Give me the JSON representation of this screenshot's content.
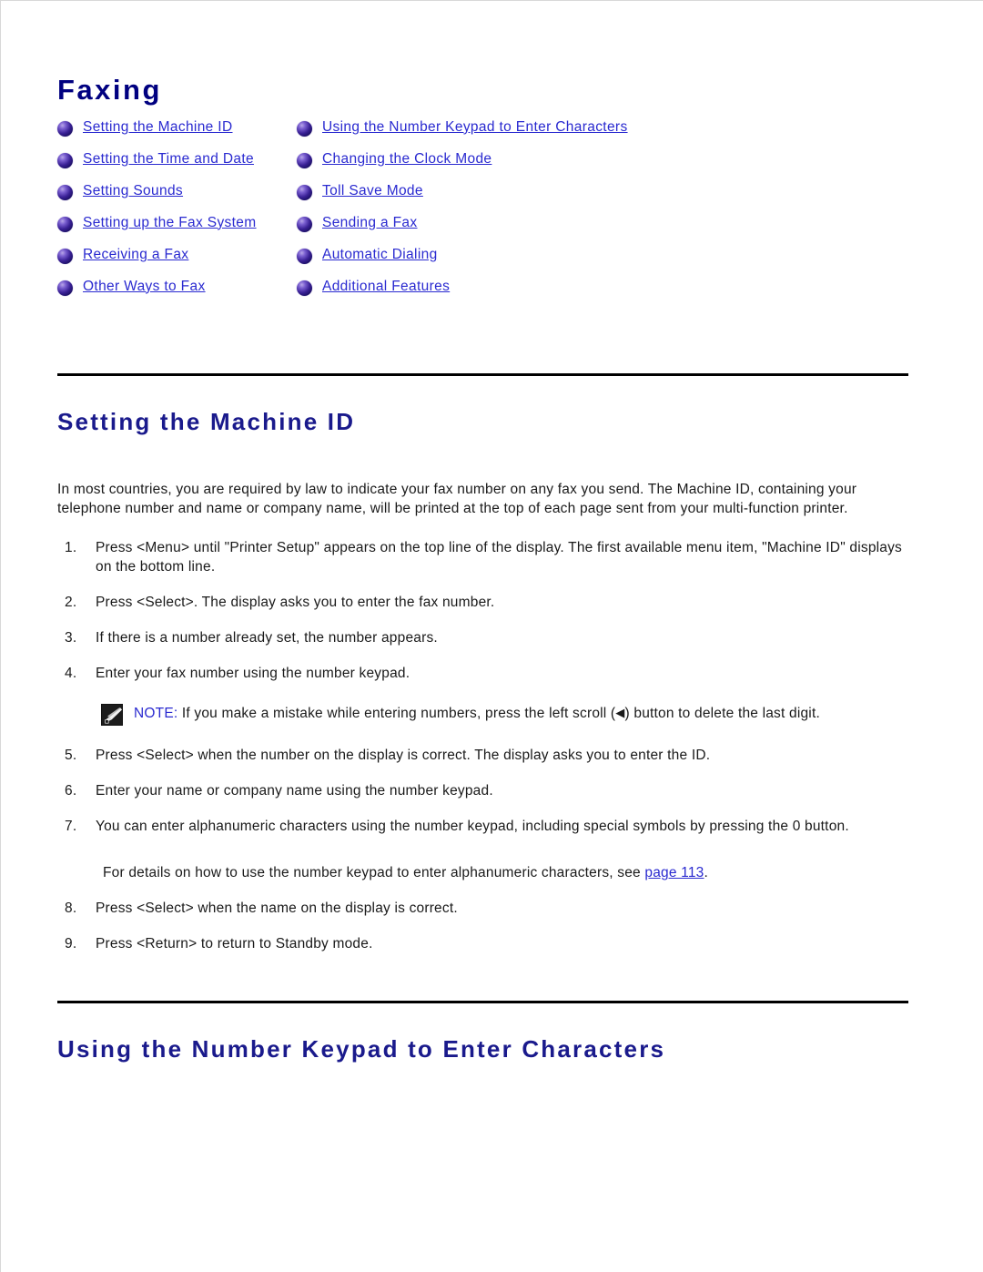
{
  "document": {
    "title": "Faxing"
  },
  "index": {
    "left_column": [
      {
        "label": "Setting the Machine ID"
      },
      {
        "label": "Setting the Time and Date"
      },
      {
        "label": "Setting Sounds"
      },
      {
        "label": "Setting up the Fax System"
      },
      {
        "label": "Receiving a Fax"
      },
      {
        "label": "Other Ways to Fax"
      }
    ],
    "right_column": [
      {
        "label": "Using the Number Keypad to Enter Characters"
      },
      {
        "label": "Changing the Clock Mode"
      },
      {
        "label": "Toll Save Mode"
      },
      {
        "label": "Sending a Fax"
      },
      {
        "label": "Automatic Dialing"
      },
      {
        "label": "Additional Features"
      }
    ],
    "bullet_icon": "sphere-bullet-icon"
  },
  "sections": [
    {
      "heading": "Setting the Machine ID",
      "intro": "In most countries, you are required by law to indicate your fax number on any fax you send. The Machine ID, containing your telephone number and name or company name, will be printed at the top of each page sent from your multi-function printer.",
      "steps": [
        {
          "number": "1.",
          "text": "Press <Menu> until \"Printer Setup\" appears on the top line of the display. The first available menu item, \"Machine ID\" displays on the bottom line."
        },
        {
          "number": "2.",
          "text": "Press <Select>. The display asks you to enter the fax number."
        },
        {
          "number": "3.",
          "text": "If there is a number already set, the number appears."
        },
        {
          "number": "4.",
          "text": "Enter your fax number using the number keypad."
        }
      ],
      "note": {
        "icon": "note-pencil-icon",
        "label": "NOTE:",
        "text_before_arrow": " If you make a mistake while entering numbers, press the left scroll (",
        "arrow": "◀",
        "text_after_arrow": ") button to delete the last digit."
      },
      "steps_after_note": [
        {
          "number": "5.",
          "text": "Press <Select> when the number on the display is correct. The display asks you to enter the ID."
        },
        {
          "number": "6.",
          "text": "Enter your name or company name using the number keypad."
        },
        {
          "number": "7.",
          "text": "You can enter alphanumeric characters using the number keypad, including special symbols by pressing the 0 button."
        }
      ],
      "detail_note": {
        "text_before_link": "For details on how to use the number keypad to enter alphanumeric characters, see ",
        "link_label": "page 113",
        "text_after_link": "."
      },
      "steps_final": [
        {
          "number": "8.",
          "text": "Press <Select> when the name on the display is correct."
        },
        {
          "number": "9.",
          "text": "Press <Return> to return to Standby mode."
        }
      ]
    },
    {
      "heading": "Using the Number Keypad to Enter Characters"
    }
  ],
  "colors": {
    "title_navy": "#000080",
    "heading_blue": "#1a1a8c",
    "link_blue": "#2a2ad0",
    "rule_black": "#000000",
    "body_text": "#1a1a1a",
    "note_icon_bg": "#1c1c1c"
  }
}
